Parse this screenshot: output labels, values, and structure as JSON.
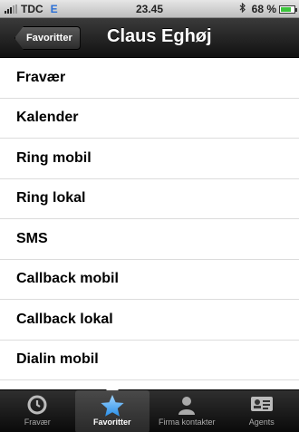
{
  "status_bar": {
    "carrier": "TDC",
    "network": "E",
    "time": "23.45",
    "bluetooth_icon": "bluetooth-icon",
    "battery_percent": "68 %",
    "battery_level": 0.68,
    "battery_color": "#3cc43c"
  },
  "nav": {
    "back_label": "Favoritter",
    "title": "Claus Eghøj"
  },
  "list": {
    "items": [
      "Fravær",
      "Kalender",
      "Ring mobil",
      "Ring lokal",
      "SMS",
      "Callback mobil",
      "Callback lokal",
      "Dialin mobil"
    ]
  },
  "tab_bar": {
    "tabs": [
      {
        "label": "Fravær",
        "icon": "clock-icon"
      },
      {
        "label": "Favoritter",
        "icon": "star-icon",
        "active": true
      },
      {
        "label": "Firma kontakter",
        "icon": "person-icon"
      },
      {
        "label": "Agents",
        "icon": "contact-card-icon"
      }
    ],
    "active_color": "#2a8fe8"
  }
}
